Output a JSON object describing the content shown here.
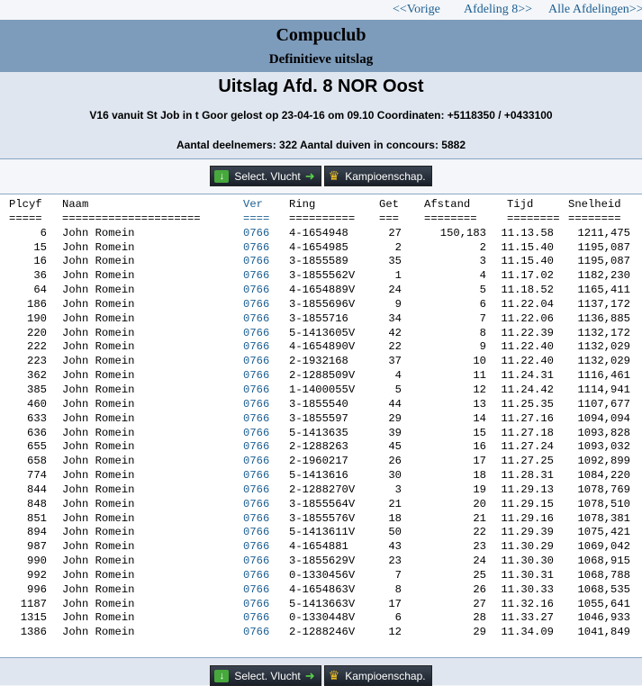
{
  "nav": {
    "prev": "<<Vorige",
    "next": "Afdeling 8>>",
    "all": "Alle Afdelingen>>"
  },
  "header": {
    "club": "Compuclub",
    "subtitle": "Definitieve uitslag"
  },
  "info": {
    "title": "Uitslag Afd. 8 NOR Oost",
    "flight": "V16 vanuit St Job in t Goor gelost op 23-04-16 om 09.10 Coordinaten: +5118350 / +0433100",
    "counts": "Aantal deelnemers: 322 Aantal duiven in concours: 5882"
  },
  "buttons": {
    "select_flight": "Select. Vlucht",
    "championship": "Kampioenschap."
  },
  "table": {
    "headers": [
      "Plcyf",
      "Naam",
      "Ver",
      "Ring",
      "Get",
      "Afstand",
      "Tijd",
      "Snelheid"
    ],
    "underline": [
      "=====",
      "=====================",
      "====",
      "==========",
      "===",
      "========",
      "========",
      "========"
    ],
    "rows": [
      [
        "6",
        "John Romein",
        "0766",
        "4-1654948",
        "27",
        "150,183",
        "11.13.58",
        "1211,475"
      ],
      [
        "15",
        "John Romein",
        "0766",
        "4-1654985",
        "2",
        "2",
        "11.15.40",
        "1195,087"
      ],
      [
        "16",
        "John Romein",
        "0766",
        "3-1855589",
        "35",
        "3",
        "11.15.40",
        "1195,087"
      ],
      [
        "36",
        "John Romein",
        "0766",
        "3-1855562V",
        "1",
        "4",
        "11.17.02",
        "1182,230"
      ],
      [
        "64",
        "John Romein",
        "0766",
        "4-1654889V",
        "24",
        "5",
        "11.18.52",
        "1165,411"
      ],
      [
        "186",
        "John Romein",
        "0766",
        "3-1855696V",
        "9",
        "6",
        "11.22.04",
        "1137,172"
      ],
      [
        "190",
        "John Romein",
        "0766",
        "3-1855716",
        "34",
        "7",
        "11.22.06",
        "1136,885"
      ],
      [
        "220",
        "John Romein",
        "0766",
        "5-1413605V",
        "42",
        "8",
        "11.22.39",
        "1132,172"
      ],
      [
        "222",
        "John Romein",
        "0766",
        "4-1654890V",
        "22",
        "9",
        "11.22.40",
        "1132,029"
      ],
      [
        "223",
        "John Romein",
        "0766",
        "2-1932168",
        "37",
        "10",
        "11.22.40",
        "1132,029"
      ],
      [
        "362",
        "John Romein",
        "0766",
        "2-1288509V",
        "4",
        "11",
        "11.24.31",
        "1116,461"
      ],
      [
        "385",
        "John Romein",
        "0766",
        "1-1400055V",
        "5",
        "12",
        "11.24.42",
        "1114,941"
      ],
      [
        "460",
        "John Romein",
        "0766",
        "3-1855540",
        "44",
        "13",
        "11.25.35",
        "1107,677"
      ],
      [
        "633",
        "John Romein",
        "0766",
        "3-1855597",
        "29",
        "14",
        "11.27.16",
        "1094,094"
      ],
      [
        "636",
        "John Romein",
        "0766",
        "5-1413635",
        "39",
        "15",
        "11.27.18",
        "1093,828"
      ],
      [
        "655",
        "John Romein",
        "0766",
        "2-1288263",
        "45",
        "16",
        "11.27.24",
        "1093,032"
      ],
      [
        "658",
        "John Romein",
        "0766",
        "2-1960217",
        "26",
        "17",
        "11.27.25",
        "1092,899"
      ],
      [
        "774",
        "John Romein",
        "0766",
        "5-1413616",
        "30",
        "18",
        "11.28.31",
        "1084,220"
      ],
      [
        "844",
        "John Romein",
        "0766",
        "2-1288270V",
        "3",
        "19",
        "11.29.13",
        "1078,769"
      ],
      [
        "848",
        "John Romein",
        "0766",
        "3-1855564V",
        "21",
        "20",
        "11.29.15",
        "1078,510"
      ],
      [
        "851",
        "John Romein",
        "0766",
        "3-1855576V",
        "18",
        "21",
        "11.29.16",
        "1078,381"
      ],
      [
        "894",
        "John Romein",
        "0766",
        "5-1413611V",
        "50",
        "22",
        "11.29.39",
        "1075,421"
      ],
      [
        "987",
        "John Romein",
        "0766",
        "4-1654881",
        "43",
        "23",
        "11.30.29",
        "1069,042"
      ],
      [
        "990",
        "John Romein",
        "0766",
        "3-1855629V",
        "23",
        "24",
        "11.30.30",
        "1068,915"
      ],
      [
        "992",
        "John Romein",
        "0766",
        "0-1330456V",
        "7",
        "25",
        "11.30.31",
        "1068,788"
      ],
      [
        "996",
        "John Romein",
        "0766",
        "4-1654863V",
        "8",
        "26",
        "11.30.33",
        "1068,535"
      ],
      [
        "1187",
        "John Romein",
        "0766",
        "5-1413663V",
        "17",
        "27",
        "11.32.16",
        "1055,641"
      ],
      [
        "1315",
        "John Romein",
        "0766",
        "0-1330448V",
        "6",
        "28",
        "11.33.27",
        "1046,933"
      ],
      [
        "1386",
        "John Romein",
        "0766",
        "2-1288246V",
        "12",
        "29",
        "11.34.09",
        "1041,849"
      ]
    ]
  }
}
